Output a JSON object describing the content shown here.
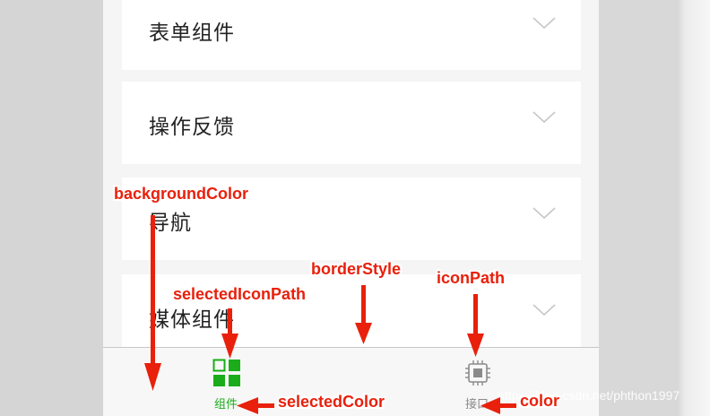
{
  "menu": {
    "items": [
      {
        "label": "表单组件",
        "icon": "chevron-down-icon"
      },
      {
        "label": "操作反馈",
        "icon": "chevron-down-icon"
      },
      {
        "label": "导航",
        "icon": "chevron-down-icon"
      },
      {
        "label": "媒体组件",
        "icon": "chevron-down-icon"
      }
    ]
  },
  "tabbar": {
    "tabs": [
      {
        "label": "组件",
        "icon": "grid-squares-icon",
        "selected": true
      },
      {
        "label": "接口",
        "icon": "chip-icon",
        "selected": false
      }
    ],
    "selected_color": "#1aad19",
    "color": "#8a8a8a"
  },
  "annotations": [
    {
      "text": "backgroundColor"
    },
    {
      "text": "borderStyle"
    },
    {
      "text": "iconPath"
    },
    {
      "text": "selectedIconPath"
    },
    {
      "text": "selectedColor"
    },
    {
      "text": "color"
    }
  ],
  "annotation_color": "#e9200c",
  "watermark": "https://blog.csdn.net/phthon1997"
}
